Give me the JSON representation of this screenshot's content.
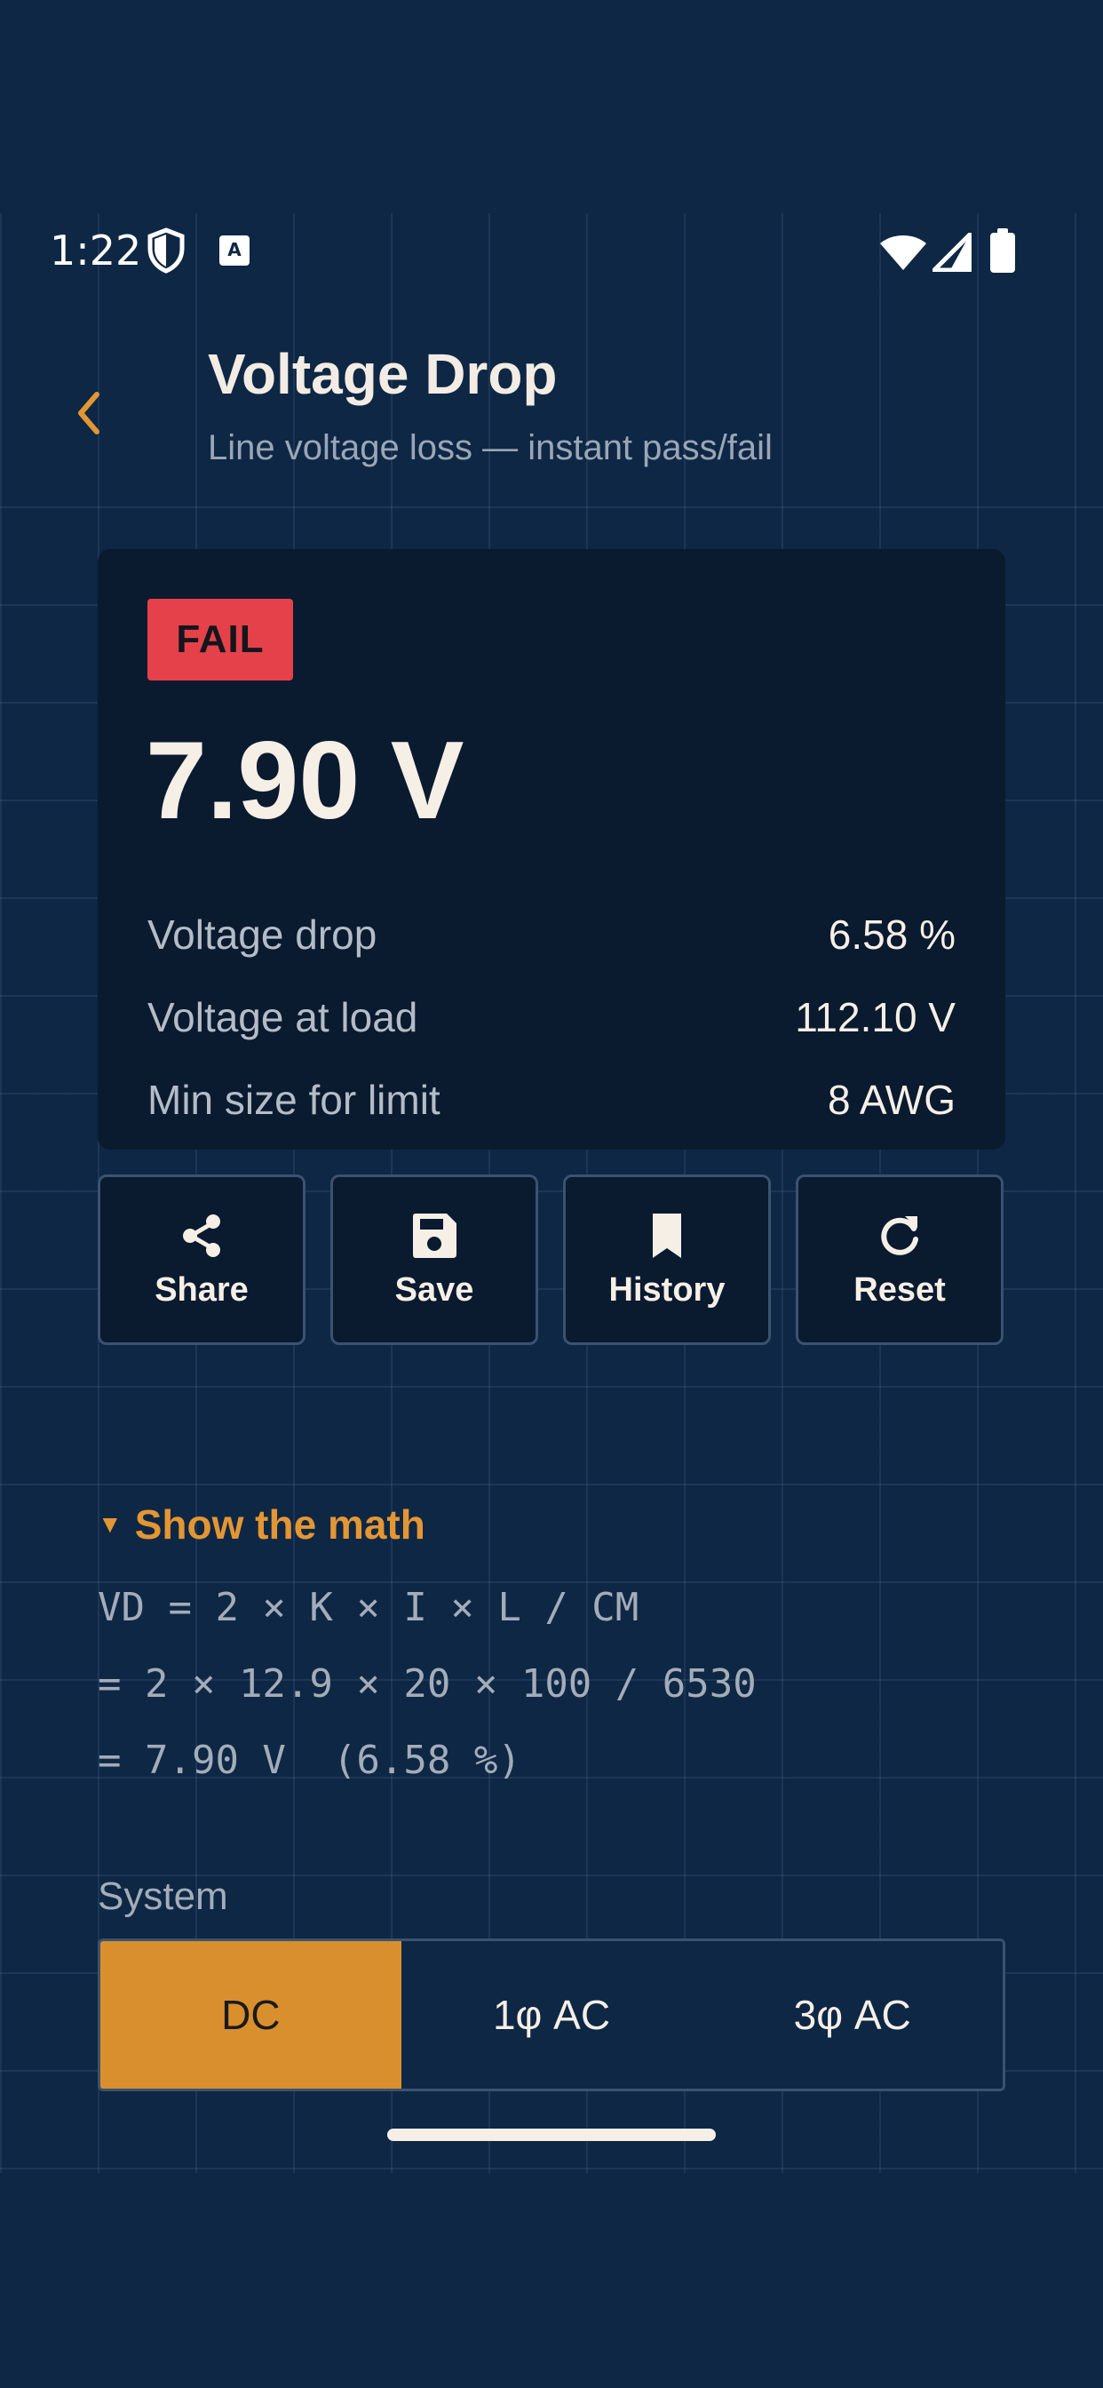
{
  "status_bar": {
    "time": "1:22"
  },
  "header": {
    "title": "Voltage Drop",
    "subtitle": "Line voltage loss — instant pass/fail"
  },
  "result": {
    "badge": "FAIL",
    "value": "7.90 V",
    "rows": [
      {
        "label": "Voltage drop",
        "value": "6.58 %"
      },
      {
        "label": "Voltage at load",
        "value": "112.10 V"
      },
      {
        "label": "Min size for limit",
        "value": "8 AWG"
      }
    ]
  },
  "actions": [
    {
      "label": "Share",
      "icon": "share-icon"
    },
    {
      "label": "Save",
      "icon": "save-icon"
    },
    {
      "label": "History",
      "icon": "bookmark-icon"
    },
    {
      "label": "Reset",
      "icon": "refresh-icon"
    }
  ],
  "math": {
    "toggle_label": "Show the math",
    "lines": [
      "VD = 2 × K × I × L / CM",
      "= 2 × 12.9 × 20 × 100 / 6530",
      "= 7.90 V  (6.58 %)"
    ]
  },
  "system": {
    "label": "System",
    "options": [
      "DC",
      "1φ AC",
      "3φ AC"
    ],
    "selected": "DC"
  },
  "colors": {
    "background": "#0e2744",
    "card": "#0a1a2f",
    "accent": "#d98f2e",
    "fail": "#e5414a"
  }
}
